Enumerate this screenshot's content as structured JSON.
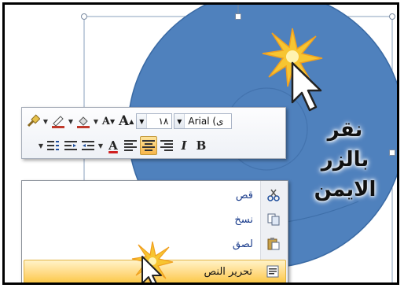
{
  "annotation": {
    "line1": "نقر",
    "line2": "بالزر",
    "line3": "الايمن"
  },
  "mini_toolbar": {
    "font_name": "Arial (ى",
    "font_size": "١٨",
    "bold_label": "B",
    "italic_label": "I",
    "font_color_label": "A",
    "grow_font_label": "A",
    "shrink_font_label": "A",
    "icons": [
      "format-painter-icon",
      "line-color-icon",
      "fill-color-icon",
      "shrink-font-icon",
      "grow-font-icon",
      "bullets-icon",
      "decrease-indent-icon",
      "increase-indent-icon",
      "font-color-icon",
      "align-left-icon",
      "center-icon",
      "align-right-icon",
      "italic-icon",
      "bold-icon"
    ]
  },
  "context_menu": {
    "items": [
      {
        "label": "قص",
        "icon": "scissors-icon"
      },
      {
        "label": "نسخ",
        "icon": "copy-icon"
      },
      {
        "label": "لصق",
        "icon": "paste-icon"
      },
      {
        "label": "تحرير النص",
        "icon": "edit-text-icon"
      }
    ],
    "highlighted_index": 3
  },
  "colors": {
    "disc": "#4f81bd",
    "burst": "#f7c531",
    "menu_highlight": "#ffd980"
  }
}
